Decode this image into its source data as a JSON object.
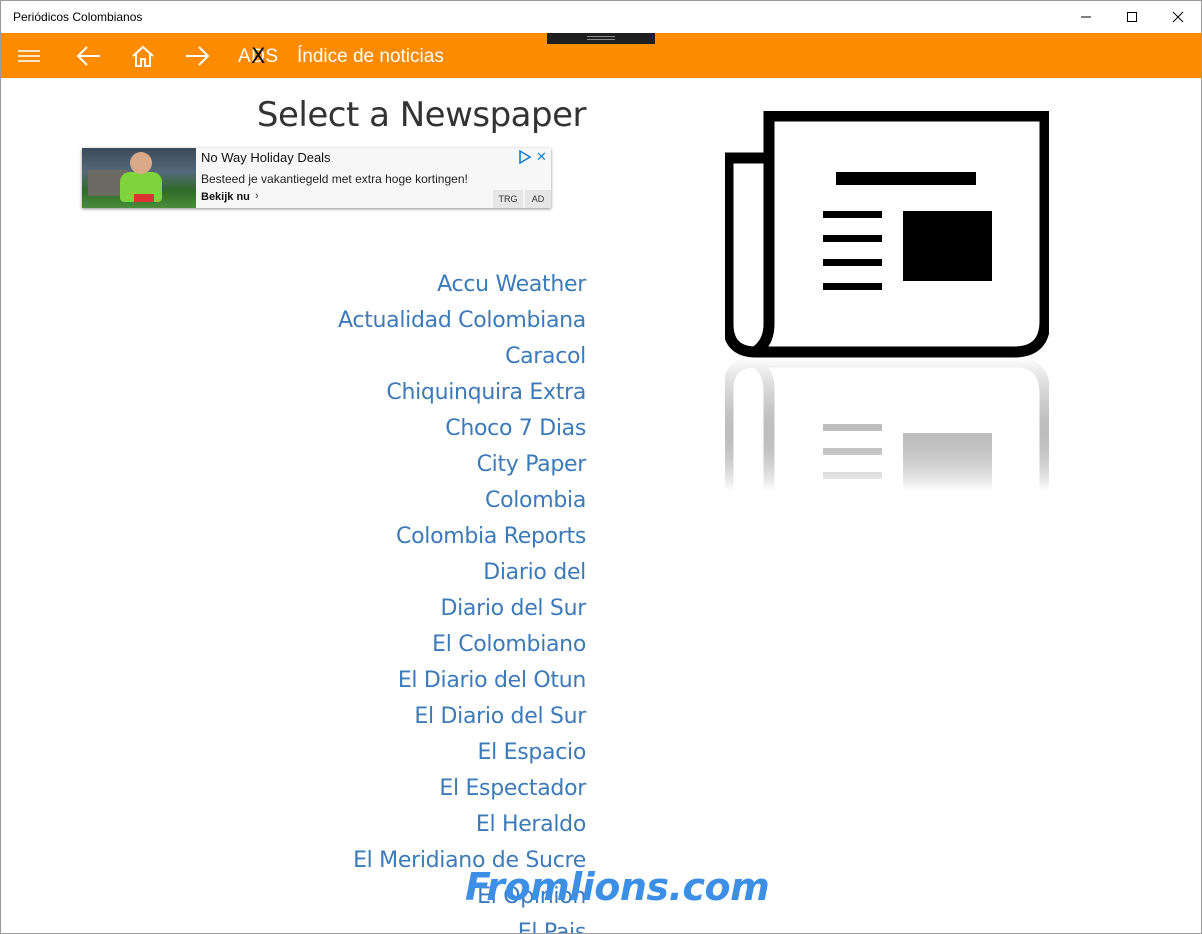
{
  "window": {
    "title": "Periódicos Colombianos"
  },
  "appbar": {
    "ads_label": "ADS",
    "ads_overlay": "X",
    "page_title": "Índice de noticias",
    "accent": "#ff8c00"
  },
  "main": {
    "heading": "Select a Newspaper",
    "link_color": "#3d7ab8",
    "newspapers": [
      "Accu Weather",
      "Actualidad Colombiana",
      "Caracol",
      "Chiquinquira Extra",
      "Choco 7 Dias",
      "City Paper",
      "Colombia",
      "Colombia Reports",
      "Diario del",
      "Diario del Sur",
      "El Colombiano",
      "El Diario del Otun",
      "El Diario del Sur",
      "El Espacio",
      "El Espectador",
      "El Heraldo",
      "El Meridiano de Sucre",
      "El Opinion",
      "El Pais"
    ]
  },
  "ad": {
    "title": "No Way Holiday Deals",
    "description": "Besteed je vakantiegeld met extra hoge kortingen!",
    "cta": "Bekijk nu",
    "cta_arrow": "›",
    "close": "✕",
    "tag_trg": "TRG",
    "tag_ad": "AD"
  },
  "watermark": {
    "text": "Fromlions.com"
  },
  "icons": {
    "hamburger": "hamburger-menu-icon",
    "back": "arrow-left-icon",
    "home": "home-icon",
    "forward": "arrow-right-icon",
    "newspaper": "newspaper-icon"
  }
}
